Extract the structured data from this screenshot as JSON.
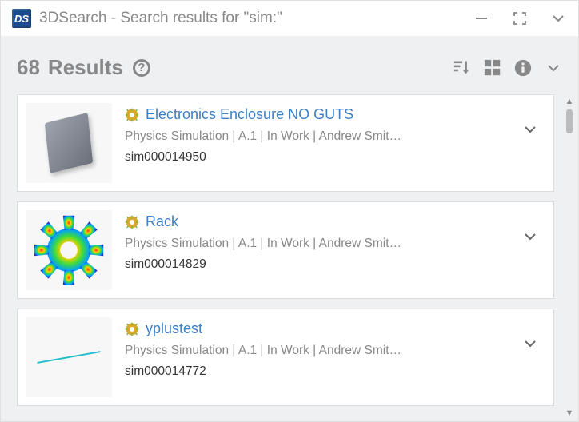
{
  "titlebar": {
    "app_badge": "DS",
    "title": "3DSearch - Search results for \"sim:\""
  },
  "results_header": {
    "count": "68",
    "label": "Results"
  },
  "results": [
    {
      "title": "Electronics Enclosure NO GUTS",
      "meta": "Physics Simulation | A.1 | In Work | Andrew Smit…",
      "id": "sim000014950",
      "thumb": "slab"
    },
    {
      "title": "Rack",
      "meta": "Physics Simulation | A.1 | In Work | Andrew Smit…",
      "id": "sim000014829",
      "thumb": "gear"
    },
    {
      "title": "yplustest",
      "meta": "Physics Simulation | A.1 | In Work | Andrew Smit…",
      "id": "sim000014772",
      "thumb": "line"
    }
  ]
}
